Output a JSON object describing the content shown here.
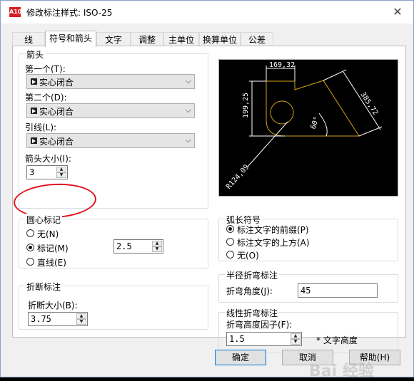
{
  "window": {
    "title": "修改标注样式: ISO-25",
    "app_icon_text": "A10",
    "close_glyph": "✕"
  },
  "tabs": [
    {
      "label": "线",
      "active": false
    },
    {
      "label": "符号和箭头",
      "active": true
    },
    {
      "label": "文字",
      "active": false
    },
    {
      "label": "调整",
      "active": false
    },
    {
      "label": "主单位",
      "active": false
    },
    {
      "label": "换算单位",
      "active": false
    },
    {
      "label": "公差",
      "active": false
    }
  ],
  "arrowheads": {
    "legend": "箭头",
    "first_label": "第一个(T):",
    "first_value": "实心闭合",
    "second_label": "第二个(D):",
    "second_value": "实心闭合",
    "leader_label": "引线(L):",
    "leader_value": "实心闭合",
    "size_label": "箭头大小(I):",
    "size_value": "3"
  },
  "center_marks": {
    "legend": "圆心标记",
    "options": [
      {
        "label": "无(N)",
        "selected": false
      },
      {
        "label": "标记(M)",
        "selected": true
      },
      {
        "label": "直线(E)",
        "selected": false
      }
    ],
    "size_value": "2.5"
  },
  "dimension_break": {
    "legend": "折断标注",
    "size_label": "折断大小(B):",
    "size_value": "3.75"
  },
  "arc_length_symbol": {
    "legend": "弧长符号",
    "options": [
      {
        "label": "标注文字的前缀(P)",
        "selected": true
      },
      {
        "label": "标注文字的上方(A)",
        "selected": false
      },
      {
        "label": "无(O)",
        "selected": false
      }
    ]
  },
  "radius_jog": {
    "legend": "半径折弯标注",
    "angle_label": "折弯角度(J):",
    "angle_value": "45"
  },
  "linear_jog": {
    "legend": "线性折弯标注",
    "factor_label": "折弯高度因子(F):",
    "factor_value": "1.5",
    "unit_label": "* 文字高度"
  },
  "preview": {
    "dim_top": "169,32",
    "dim_left": "199,25",
    "dim_right": "385,72",
    "dim_angle": "60°",
    "dim_radius": "R124,09"
  },
  "buttons": {
    "ok": "确定",
    "cancel": "取消",
    "help": "帮助(H)"
  },
  "watermark": "Bai 经验",
  "colors": {
    "preview_geometry": "#d4a017",
    "preview_dims": "#ffffff",
    "highlight": "#e0141e"
  }
}
